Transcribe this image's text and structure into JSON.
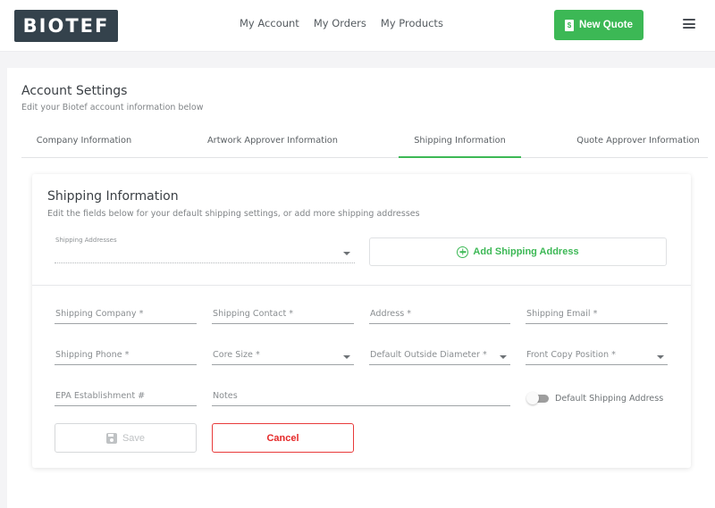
{
  "header": {
    "logo_text": "BIOTEF",
    "nav": [
      {
        "label": "My Account"
      },
      {
        "label": "My Orders"
      },
      {
        "label": "My Products"
      }
    ],
    "new_quote_label": "New Quote",
    "new_quote_icon": "dollar-document-icon",
    "menu_icon": "hamburger-icon"
  },
  "page": {
    "title": "Account Settings",
    "subtitle": "Edit your Biotef account information below"
  },
  "tabs": [
    {
      "label": "Company Information",
      "active": false
    },
    {
      "label": "Artwork Approver Information",
      "active": false
    },
    {
      "label": "Shipping Information",
      "active": true
    },
    {
      "label": "Quote Approver Information",
      "active": false
    }
  ],
  "card": {
    "title": "Shipping Information",
    "subtitle": "Edit the fields below for your default shipping settings, or add more shipping addresses",
    "shipping_addresses": {
      "label": "Shipping Addresses",
      "value": ""
    },
    "add_address_label": "Add Shipping Address",
    "fields": {
      "shipping_company": {
        "placeholder": "Shipping Company *",
        "value": ""
      },
      "shipping_contact": {
        "placeholder": "Shipping Contact *",
        "value": ""
      },
      "address": {
        "placeholder": "Address *",
        "value": ""
      },
      "shipping_email": {
        "placeholder": "Shipping Email *",
        "value": ""
      },
      "shipping_phone": {
        "placeholder": "Shipping Phone *",
        "value": ""
      },
      "core_size": {
        "placeholder": "Core Size *",
        "value": ""
      },
      "default_outside_diameter": {
        "placeholder": "Default Outside Diameter *",
        "value": ""
      },
      "front_copy_position": {
        "placeholder": "Front Copy Position *",
        "value": ""
      },
      "epa_establishment": {
        "placeholder": "EPA Establishment #",
        "value": ""
      },
      "notes": {
        "placeholder": "Notes",
        "value": ""
      }
    },
    "default_toggle": {
      "label": "Default Shipping Address",
      "on": false
    },
    "save_label": "Save",
    "cancel_label": "Cancel"
  },
  "colors": {
    "brand_dark": "#34424c",
    "accent_green": "#3cb855",
    "danger_red": "#e52828"
  }
}
